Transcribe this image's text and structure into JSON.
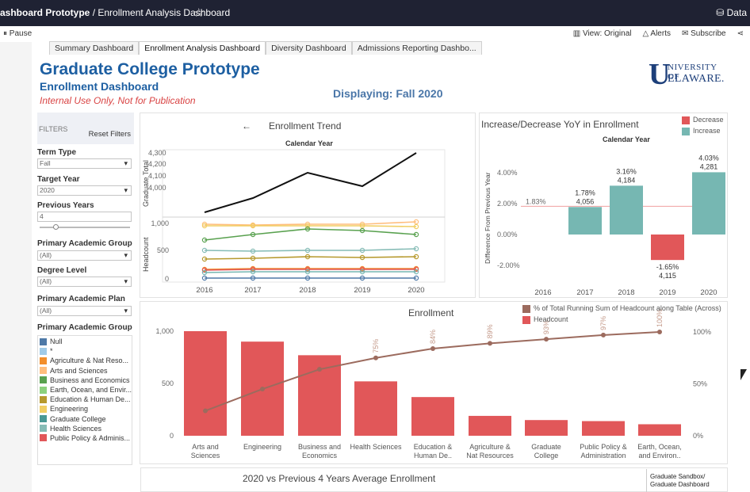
{
  "topbar": {
    "breadcrumb_bold": "ashboard Prototype",
    "breadcrumb_sep": " / ",
    "breadcrumb_page": "Enrollment Analysis Dashboard",
    "star_icon": "star-outline-icon",
    "right_label": "Data"
  },
  "toolbar": {
    "pause_label": "Pause",
    "view_label": "View: Original",
    "alerts_label": "Alerts",
    "subscribe_label": "Subscribe"
  },
  "tabs": [
    {
      "label": "Summary Dashboard",
      "active": false
    },
    {
      "label": "Enrollment Analysis Dashboard",
      "active": true
    },
    {
      "label": "Diversity Dashboard",
      "active": false
    },
    {
      "label": "Admissions Reporting Dashbo...",
      "active": false
    }
  ],
  "header": {
    "title": "Graduate College Prototype",
    "subtitle": "Enrollment Dashboard",
    "internal": "Internal Use Only, Not for Publication",
    "displaying": "Displaying: Fall 2020",
    "logo_line1": "NIVERSITY OF",
    "logo_line2": "ELAWARE."
  },
  "filters": {
    "head_label": "FILTERS",
    "reset_label": "Reset Filters",
    "term_type_label": "Term Type",
    "term_type_value": "Fall",
    "target_year_label": "Target Year",
    "target_year_value": "2020",
    "previous_years_label": "Previous Years",
    "previous_years_value": "4",
    "primary_group_label": "Primary Academic Group",
    "primary_group_value": "(All)",
    "degree_level_label": "Degree Level",
    "degree_level_value": "(All)",
    "primary_plan_label": "Primary Academic Plan",
    "primary_plan_value": "(All)",
    "legend_label": "Primary Academic Group",
    "legend_items": [
      {
        "label": "Null",
        "color": "#4e79a7"
      },
      {
        "label": "*",
        "color": "#a0cbe8"
      },
      {
        "label": "Agriculture & Nat Reso...",
        "color": "#f28e2b"
      },
      {
        "label": "Arts and Sciences",
        "color": "#ffbe7d"
      },
      {
        "label": "Business and Economics",
        "color": "#59a14f"
      },
      {
        "label": "Earth, Ocean, and Envir...",
        "color": "#8cd17d"
      },
      {
        "label": "Education & Human De...",
        "color": "#b6992d"
      },
      {
        "label": "Engineering",
        "color": "#f1ce63"
      },
      {
        "label": "Graduate College",
        "color": "#499894"
      },
      {
        "label": "Health Sciences",
        "color": "#86bcb6"
      },
      {
        "label": "Public Policy & Adminis...",
        "color": "#e15759"
      }
    ]
  },
  "trend": {
    "arrow": "←",
    "title": "Enrollment Trend",
    "subtitle": "Calendar Year",
    "ylabel_top": "Graduate Total",
    "ylabel_bottom": "Headcount",
    "years": [
      "2016",
      "2017",
      "2018",
      "2019",
      "2020"
    ],
    "top_ticks": [
      "4,300",
      "4,200",
      "4,100",
      "4,000"
    ],
    "bottom_ticks": [
      "1,000",
      "500",
      "0"
    ]
  },
  "yoy": {
    "title": "Increase/Decrease YoY in Enrollment",
    "subtitle": "Calendar Year",
    "ylabel": "Difference From Previous Year",
    "legend_decrease": "Decrease",
    "legend_increase": "Increase",
    "color_decrease": "#e15759",
    "color_increase": "#76b7b2",
    "ticks": [
      "4.00%",
      "2.00%",
      "0.00%",
      "-2.00%"
    ],
    "ref_label": "1.83%",
    "years": [
      "2016",
      "2017",
      "2018",
      "2019",
      "2020"
    ],
    "labels": [
      {
        "pct": "1.78%",
        "val": "4,056"
      },
      {
        "pct": "3.16%",
        "val": "4,184"
      },
      {
        "pct": "-1.65%",
        "val": "4,115"
      },
      {
        "pct": "4.03%",
        "val": "4,281"
      }
    ]
  },
  "enrollment": {
    "title": "Enrollment",
    "legend_line": "% of Total Running Sum of Headcount along Table (Across)",
    "legend_bar": "Headcount",
    "line_color": "#9c6b5e",
    "bar_color": "#e15759",
    "left_ticks": [
      "1,000",
      "500",
      "0"
    ],
    "right_ticks": [
      "100%",
      "50%",
      "0%"
    ],
    "categories": [
      {
        "l1": "Arts and",
        "l2": "Sciences"
      },
      {
        "l1": "Engineering",
        "l2": ""
      },
      {
        "l1": "Business and",
        "l2": "Economics"
      },
      {
        "l1": "Health Sciences",
        "l2": ""
      },
      {
        "l1": "Education &",
        "l2": "Human De.."
      },
      {
        "l1": "Agriculture &",
        "l2": "Nat Resources"
      },
      {
        "l1": "Graduate",
        "l2": "College"
      },
      {
        "l1": "Public Policy &",
        "l2": "Administration"
      },
      {
        "l1": "Earth, Ocean,",
        "l2": "and Environ.."
      }
    ],
    "pct_labels": [
      "",
      "",
      "",
      "75%",
      "84%",
      "89%",
      "93%",
      "97%",
      "100%"
    ]
  },
  "chart_data": {
    "type": "bar",
    "title": "Enrollment",
    "categories": [
      "Arts and Sciences",
      "Engineering",
      "Business and Economics",
      "Health Sciences",
      "Education & Human De..",
      "Agriculture & Nat Resources",
      "Graduate College",
      "Public Policy & Administration",
      "Earth, Ocean, and Environ.."
    ],
    "series": [
      {
        "name": "Headcount",
        "values": [
          1000,
          900,
          770,
          520,
          370,
          190,
          150,
          140,
          110
        ]
      },
      {
        "name": "% of Total Running Sum of Headcount along Table (Across)",
        "values": [
          24,
          45,
          64,
          75,
          84,
          89,
          93,
          97,
          100
        ]
      }
    ],
    "ylim": [
      0,
      1100
    ],
    "y2lim": [
      0,
      120
    ]
  },
  "bottom": {
    "title": "2020 vs Previous 4 Years Average Enrollment",
    "sandbox_line1": "Graduate Sandbox/",
    "sandbox_line2": "Graduate Dashboard"
  }
}
